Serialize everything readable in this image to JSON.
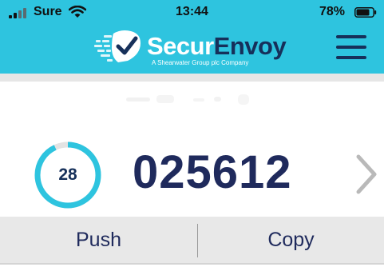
{
  "status_bar": {
    "carrier": "Sure",
    "time": "13:44",
    "battery": "78%"
  },
  "header": {
    "brand_part1": "Secur",
    "brand_part2": "Envoy",
    "tagline": "A Shearwater Group plc Company",
    "menu_icon": "hamburger-menu-icon",
    "accent_color": "#2ec4df",
    "brand_color": "#16305a"
  },
  "token": {
    "seconds_remaining": "28",
    "countdown_fraction": 0.93,
    "passcode": "025612",
    "next_icon": "chevron-right-icon"
  },
  "actions": {
    "push_label": "Push",
    "copy_label": "Copy"
  }
}
